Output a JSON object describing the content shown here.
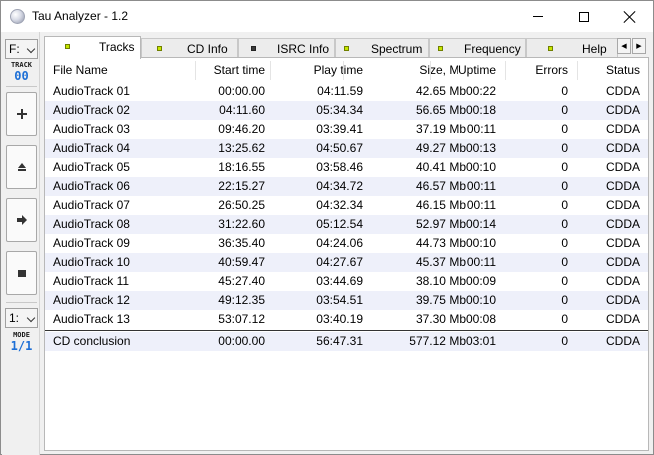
{
  "window": {
    "title": "Tau Analyzer - 1.2"
  },
  "left_panel": {
    "drive": "F:",
    "track_label": "TRACK",
    "track_value": "00",
    "mode_select": "1:",
    "mode_label": "MODE",
    "mode_value": "1/1",
    "buttons": [
      "+",
      "eject",
      "play",
      "stop"
    ]
  },
  "tabs": [
    {
      "label": "Tracks",
      "active": true,
      "bullet": "lime"
    },
    {
      "label": "CD Info",
      "active": false,
      "bullet": "lime"
    },
    {
      "label": "ISRC Info",
      "active": false,
      "bullet": "dark"
    },
    {
      "label": "Spectrum",
      "active": false,
      "bullet": "lime"
    },
    {
      "label": "Frequency",
      "active": false,
      "bullet": "lime"
    },
    {
      "label": "Help",
      "active": false,
      "bullet": "lime"
    }
  ],
  "table": {
    "columns": [
      "File Name",
      "Start time",
      "Play time",
      "Size, Mb",
      "Uptime",
      "Errors",
      "Status"
    ],
    "rows": [
      [
        "AudioTrack 01",
        "00:00.00",
        "04:11.59",
        "42.65 Mb",
        "00:22",
        "0",
        "CDDA"
      ],
      [
        "AudioTrack 02",
        "04:11.60",
        "05:34.34",
        "56.65 Mb",
        "00:18",
        "0",
        "CDDA"
      ],
      [
        "AudioTrack 03",
        "09:46.20",
        "03:39.41",
        "37.19 Mb",
        "00:11",
        "0",
        "CDDA"
      ],
      [
        "AudioTrack 04",
        "13:25.62",
        "04:50.67",
        "49.27 Mb",
        "00:13",
        "0",
        "CDDA"
      ],
      [
        "AudioTrack 05",
        "18:16.55",
        "03:58.46",
        "40.41 Mb",
        "00:10",
        "0",
        "CDDA"
      ],
      [
        "AudioTrack 06",
        "22:15.27",
        "04:34.72",
        "46.57 Mb",
        "00:11",
        "0",
        "CDDA"
      ],
      [
        "AudioTrack 07",
        "26:50.25",
        "04:32.34",
        "46.15 Mb",
        "00:11",
        "0",
        "CDDA"
      ],
      [
        "AudioTrack 08",
        "31:22.60",
        "05:12.54",
        "52.97 Mb",
        "00:14",
        "0",
        "CDDA"
      ],
      [
        "AudioTrack 09",
        "36:35.40",
        "04:24.06",
        "44.73 Mb",
        "00:10",
        "0",
        "CDDA"
      ],
      [
        "AudioTrack 10",
        "40:59.47",
        "04:27.67",
        "45.37 Mb",
        "00:11",
        "0",
        "CDDA"
      ],
      [
        "AudioTrack 11",
        "45:27.40",
        "03:44.69",
        "38.10 Mb",
        "00:09",
        "0",
        "CDDA"
      ],
      [
        "AudioTrack 12",
        "49:12.35",
        "03:54.51",
        "39.75 Mb",
        "00:10",
        "0",
        "CDDA"
      ],
      [
        "AudioTrack 13",
        "53:07.12",
        "03:40.19",
        "37.30 Mb",
        "00:08",
        "0",
        "CDDA"
      ]
    ],
    "total": [
      "CD conclusion",
      "00:00.00",
      "56:47.31",
      "577.12 Mb",
      "03:01",
      "0",
      "CDDA"
    ]
  }
}
